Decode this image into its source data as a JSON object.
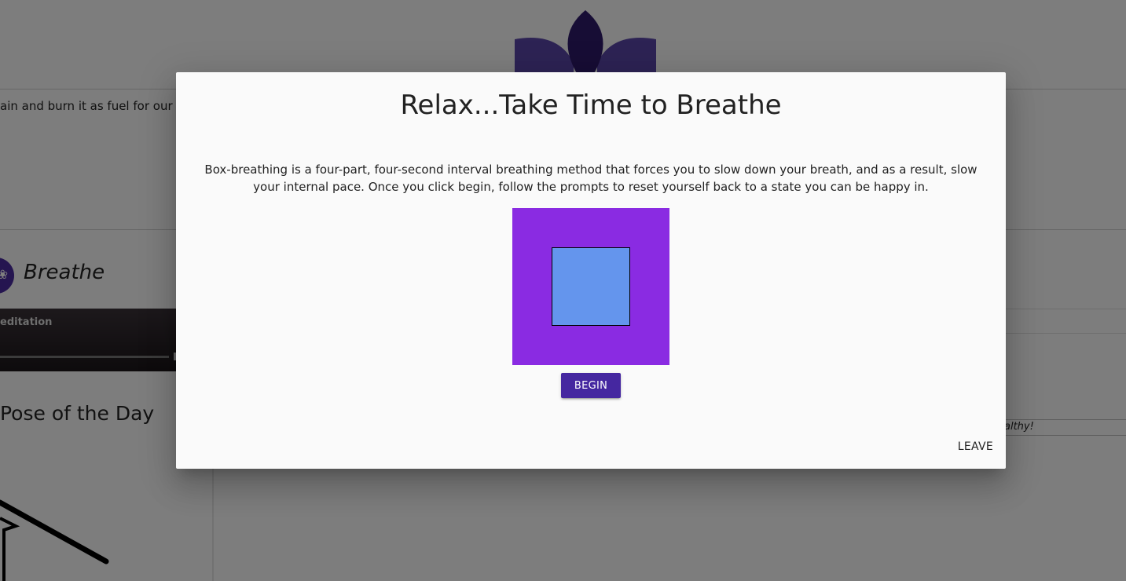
{
  "background": {
    "intro_text": "ain and burn it as fuel for our",
    "breathe_title": "Breathe",
    "player_label": "editation",
    "pose_title": "Pose of the Day",
    "right_caption": "althy!"
  },
  "modal": {
    "title": "Relax...Take Time to Breathe",
    "description": "Box-breathing is a four-part, four-second interval breathing method that forces you to slow down your breath, and as a result, slow your internal pace. Once you click begin, follow the prompts to reset yourself back to a state you can be happy in.",
    "begin_label": "BEGIN",
    "leave_label": "LEAVE"
  },
  "colors": {
    "accent": "#4527a0",
    "box_outer": "#8a2be2",
    "box_inner": "#6495ed",
    "logo": "#3f2a87"
  }
}
